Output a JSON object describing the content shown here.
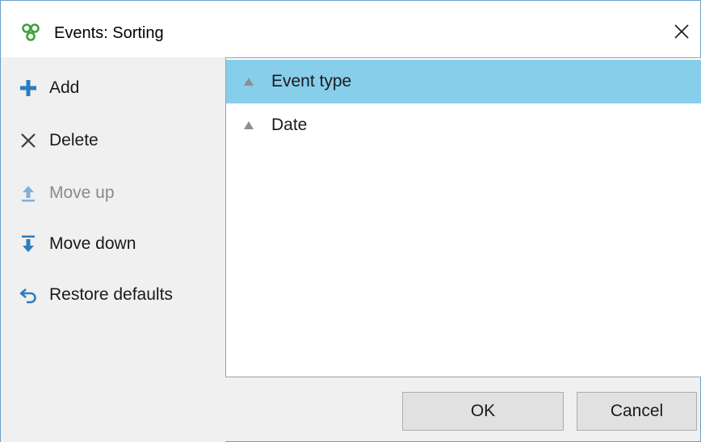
{
  "window": {
    "title": "Events: Sorting",
    "app_icon": "app-logo-icon",
    "close_icon": "close-icon"
  },
  "sidebar": {
    "items": [
      {
        "label": "Add",
        "icon": "plus-icon",
        "enabled": true
      },
      {
        "label": "Delete",
        "icon": "delete-x-icon",
        "enabled": true
      },
      {
        "label": "Move up",
        "icon": "move-up-icon",
        "enabled": false
      },
      {
        "label": "Move down",
        "icon": "move-down-icon",
        "enabled": true
      },
      {
        "label": "Restore defaults",
        "icon": "undo-arrow-icon",
        "enabled": true
      }
    ]
  },
  "sort_list": {
    "rows": [
      {
        "label": "Event type",
        "selected": true,
        "direction_icon": "ascending-triangle-icon"
      },
      {
        "label": "Date",
        "selected": false,
        "direction_icon": "ascending-triangle-icon"
      }
    ]
  },
  "buttons": {
    "ok_label": "OK",
    "cancel_label": "Cancel"
  },
  "colors": {
    "selection": "#87ceeb",
    "accent_blue": "#2b7cc1",
    "app_icon_green": "#3ba33b"
  }
}
